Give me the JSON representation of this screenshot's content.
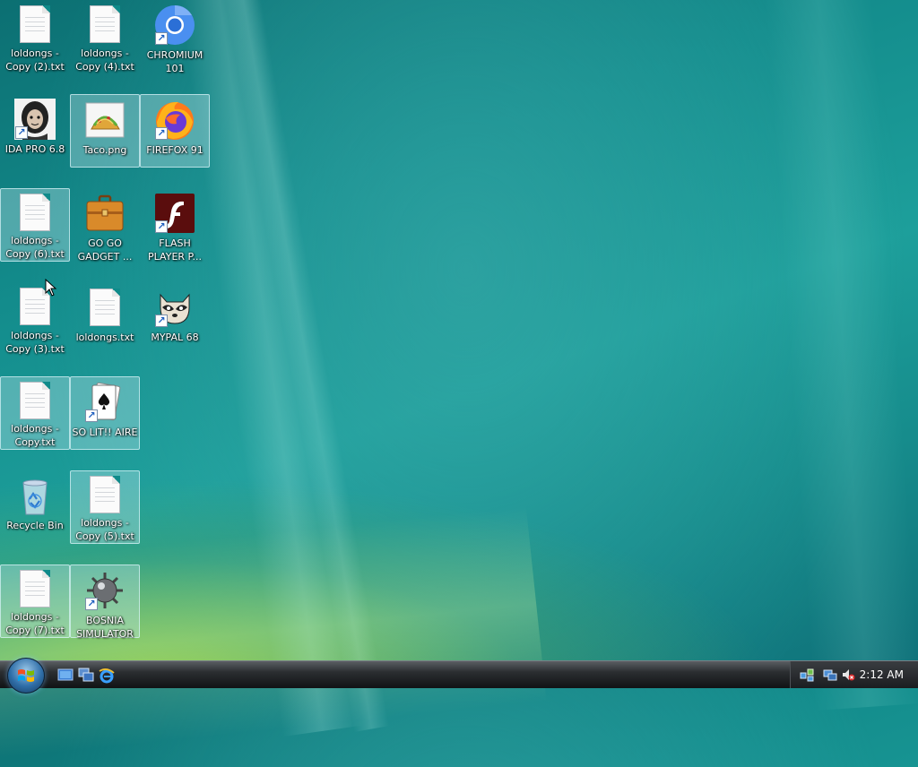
{
  "desktop": {
    "icons": [
      {
        "label": "loldongs - Copy (2).txt",
        "icon": "text-file-icon"
      },
      {
        "label": "loldongs - Copy (4).txt",
        "icon": "text-file-icon"
      },
      {
        "label": "CHROMIUM 101",
        "icon": "chromium-icon"
      },
      {
        "label": "IDA PRO 6.8",
        "icon": "ida-pro-icon"
      },
      {
        "label": "Taco.png",
        "icon": "taco-image-icon"
      },
      {
        "label": "FIREFOX 91",
        "icon": "firefox-icon"
      },
      {
        "label": "loldongs - Copy (6).txt",
        "icon": "text-file-icon"
      },
      {
        "label": "GO GO GADGET ...",
        "icon": "briefcase-icon"
      },
      {
        "label": "FLASH PLAYER P...",
        "icon": "flash-player-icon"
      },
      {
        "label": "loldongs - Copy (3).txt",
        "icon": "text-file-icon"
      },
      {
        "label": "loldongs.txt",
        "icon": "text-file-icon"
      },
      {
        "label": "MYPAL 68",
        "icon": "raccoon-icon"
      },
      {
        "label": "loldongs - Copy.txt",
        "icon": "text-file-icon"
      },
      {
        "label": "SO LIT!! AIRE",
        "icon": "solitaire-cards-icon"
      },
      {
        "label": "Recycle Bin",
        "icon": "recycle-bin-icon"
      },
      {
        "label": "loldongs - Copy (5).txt",
        "icon": "text-file-icon"
      },
      {
        "label": "loldongs - Copy (7).txt",
        "icon": "text-file-icon"
      },
      {
        "label": "BOSNIA SIMULATOR",
        "icon": "minesweeper-mine-icon"
      }
    ]
  },
  "taskbar": {
    "start": "windows-start-orb-icon",
    "quick_launch": [
      "show-desktop-icon",
      "switch-windows-icon",
      "internet-explorer-icon"
    ],
    "tray": [
      "network-icon",
      "connection-icon",
      "muted-volume-icon"
    ],
    "clock": "2:12 AM"
  }
}
